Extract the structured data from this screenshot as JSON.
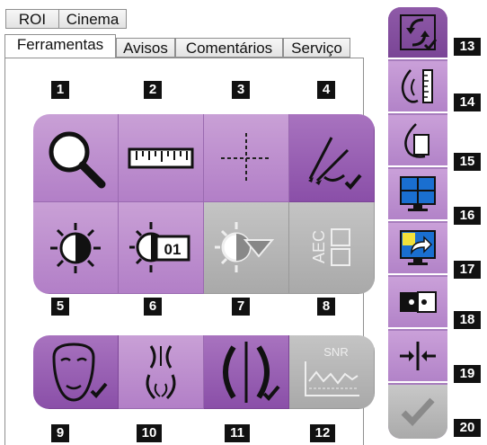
{
  "top_tabs": [
    {
      "label": "ROI"
    },
    {
      "label": "Cinema"
    }
  ],
  "bottom_tabs": [
    {
      "label": "Ferramentas"
    },
    {
      "label": "Avisos"
    },
    {
      "label": "Comentários"
    },
    {
      "label": "Serviço"
    }
  ],
  "active_tab": "Ferramentas",
  "callouts": {
    "n1": "1",
    "n2": "2",
    "n3": "3",
    "n4": "4",
    "n5": "5",
    "n6": "6",
    "n7": "7",
    "n8": "8",
    "n9": "9",
    "n10": "10",
    "n11": "11",
    "n12": "12",
    "n13": "13",
    "n14": "14",
    "n15": "15",
    "n16": "16",
    "n17": "17",
    "n18": "18",
    "n19": "19",
    "n20": "20"
  },
  "tools": {
    "window_level_preset": "01",
    "aec_label": "AEC",
    "snr_label": "SNR"
  },
  "colors": {
    "accent_purple": "#b27fc7",
    "selected_purple": "#8a4fa8",
    "disabled_gray": "#b0b0b0",
    "callout_black": "#111111",
    "check_color": "#4a2a5c"
  }
}
